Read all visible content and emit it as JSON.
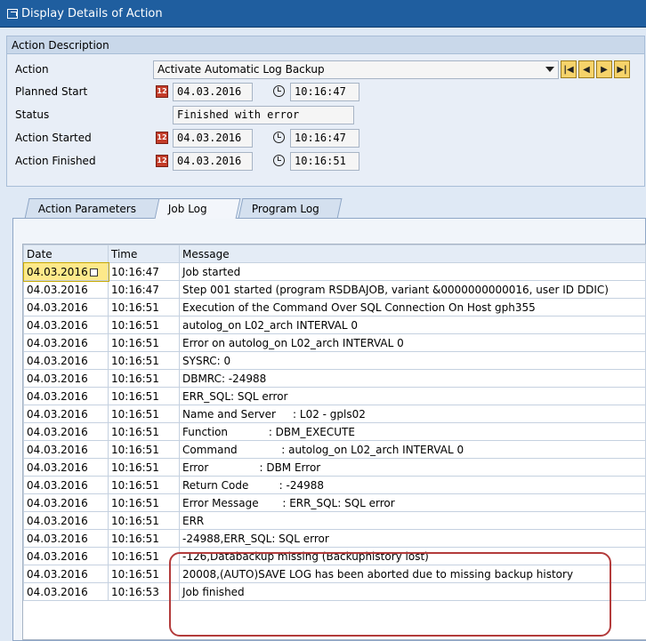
{
  "window": {
    "title": "Display Details of Action"
  },
  "action_description": {
    "header": "Action Description",
    "fields": {
      "action": {
        "label": "Action",
        "value": "Activate Automatic Log Backup"
      },
      "planned_start": {
        "label": "Planned Start",
        "date": "04.03.2016",
        "time": "10:16:47"
      },
      "status": {
        "label": "Status",
        "value": "Finished with error"
      },
      "action_started": {
        "label": "Action Started",
        "date": "04.03.2016",
        "time": "10:16:47"
      },
      "action_finished": {
        "label": "Action Finished",
        "date": "04.03.2016",
        "time": "10:16:51"
      }
    }
  },
  "tabs": [
    {
      "label": "Action Parameters",
      "active": false
    },
    {
      "label": "Job Log",
      "active": true
    },
    {
      "label": "Program Log",
      "active": false
    }
  ],
  "job_log": {
    "columns": [
      "Date",
      "Time",
      "Message"
    ],
    "rows": [
      [
        "04.03.2016",
        "10:16:47",
        "Job started"
      ],
      [
        "04.03.2016",
        "10:16:47",
        "Step 001 started (program RSDBAJOB, variant &0000000000016, user ID DDIC)"
      ],
      [
        "04.03.2016",
        "10:16:51",
        "Execution of the Command Over SQL Connection On Host gph355"
      ],
      [
        "04.03.2016",
        "10:16:51",
        "autolog_on L02_arch INTERVAL 0"
      ],
      [
        "04.03.2016",
        "10:16:51",
        "Error on autolog_on L02_arch INTERVAL 0"
      ],
      [
        "04.03.2016",
        "10:16:51",
        "SYSRC: 0"
      ],
      [
        "04.03.2016",
        "10:16:51",
        "DBMRC: -24988"
      ],
      [
        "04.03.2016",
        "10:16:51",
        "ERR_SQL: SQL error"
      ],
      [
        "04.03.2016",
        "10:16:51",
        "Name and Server     : L02 - gpls02"
      ],
      [
        "04.03.2016",
        "10:16:51",
        "Function            : DBM_EXECUTE"
      ],
      [
        "04.03.2016",
        "10:16:51",
        "Command             : autolog_on L02_arch INTERVAL 0"
      ],
      [
        "04.03.2016",
        "10:16:51",
        "Error               : DBM Error"
      ],
      [
        "04.03.2016",
        "10:16:51",
        "Return Code         : -24988"
      ],
      [
        "04.03.2016",
        "10:16:51",
        "Error Message       : ERR_SQL: SQL error"
      ],
      [
        "04.03.2016",
        "10:16:51",
        "ERR"
      ],
      [
        "04.03.2016",
        "10:16:51",
        "-24988,ERR_SQL: SQL error"
      ],
      [
        "04.03.2016",
        "10:16:51",
        "-126,Databackup missing (Backuphistory lost)"
      ],
      [
        "04.03.2016",
        "10:16:51",
        "20008,(AUTO)SAVE LOG has been aborted due to missing backup history"
      ],
      [
        "04.03.2016",
        "10:16:53",
        "Job finished"
      ]
    ]
  },
  "colors": {
    "titlebar": "#1f5e9f",
    "highlight": "#b33b3b",
    "selected_cell": "#fde98a"
  }
}
